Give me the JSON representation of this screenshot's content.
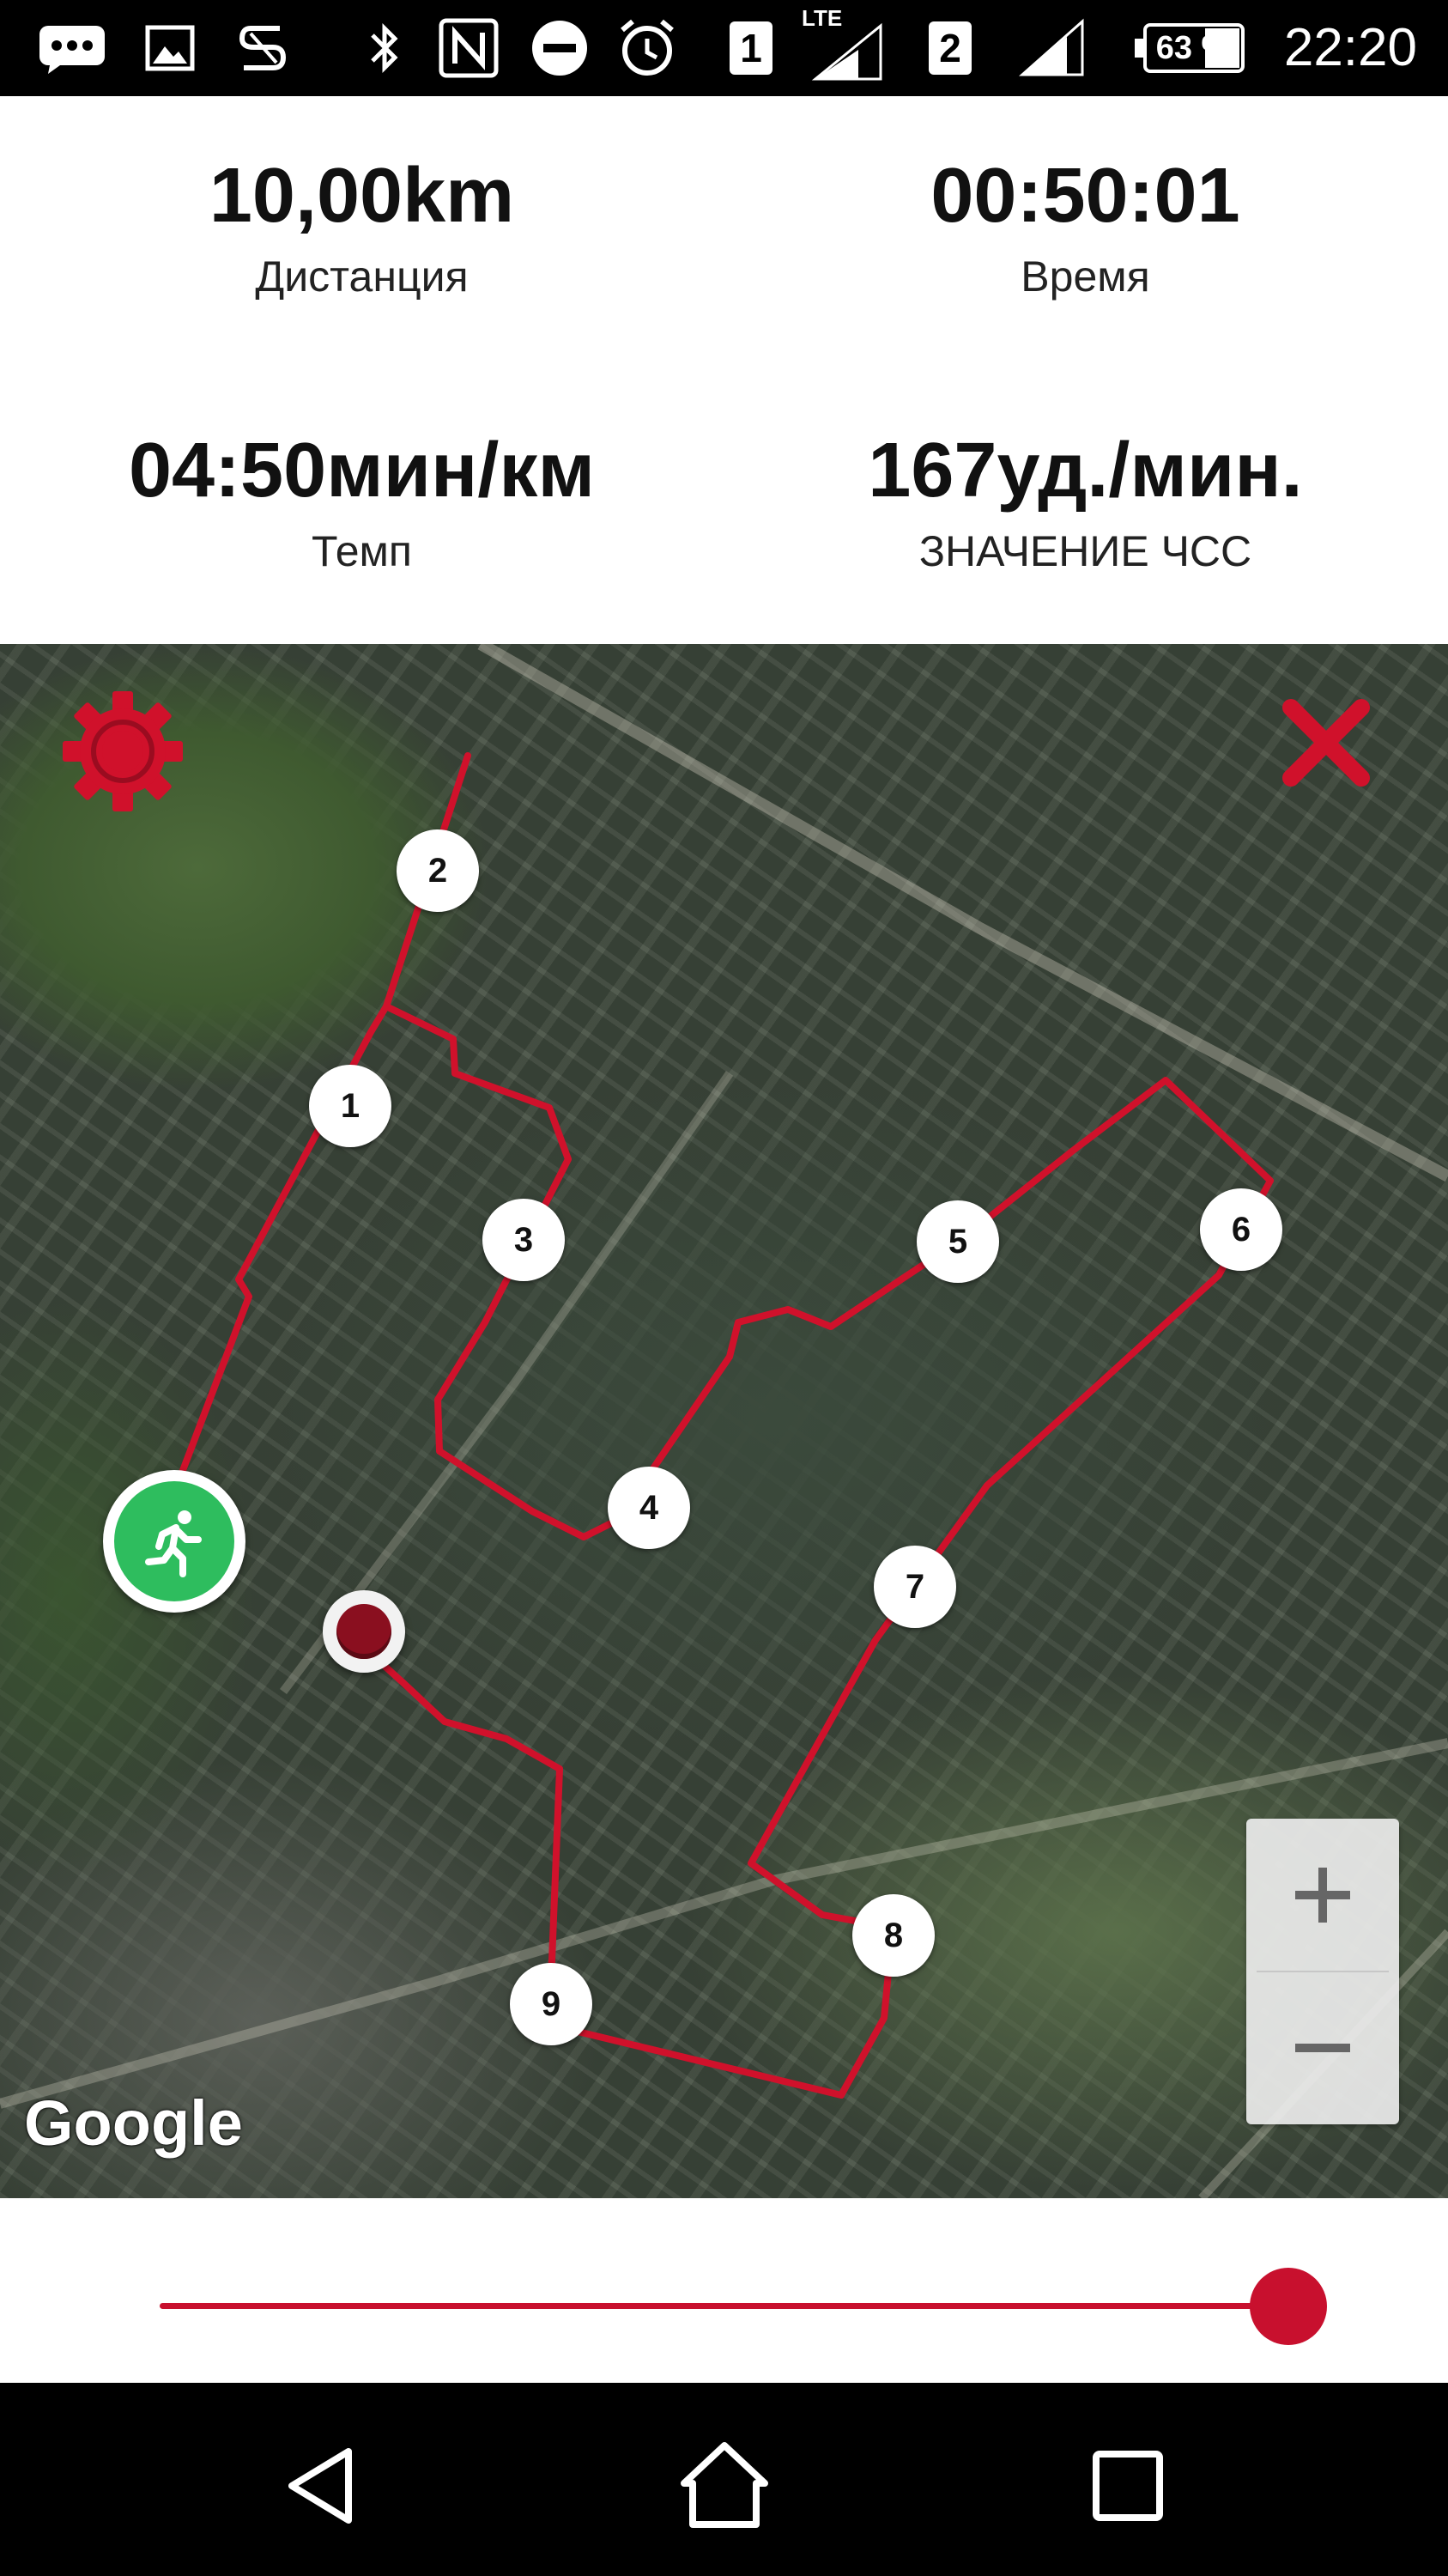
{
  "status_bar": {
    "time": "22:20",
    "battery_percent": "63 %",
    "sim1_label": "1",
    "sim2_label": "2",
    "network_type": "LTE",
    "icons": [
      "chat-icon",
      "image-icon",
      "app-s-icon",
      "bluetooth-icon",
      "nfc-icon",
      "do-not-disturb-icon",
      "alarm-icon",
      "sim1-icon",
      "signal-icon",
      "sim2-icon",
      "signal-icon",
      "battery-icon"
    ]
  },
  "stats": {
    "distance_value": "10,00km",
    "distance_label": "Дистанция",
    "time_value": "00:50:01",
    "time_label": "Время",
    "pace_value": "04:50мин/км",
    "pace_label": "Темп",
    "hr_value": "167уд./мин.",
    "hr_label": "ЗНАЧЕНИЕ ЧСС"
  },
  "map": {
    "provider_logo": "Google",
    "route_color": "#d0112b",
    "km_markers": [
      "1",
      "2",
      "3",
      "4",
      "5",
      "6",
      "7",
      "8",
      "9"
    ],
    "start_icon": "runner-icon",
    "end_icon": "finish-pin-icon",
    "settings_icon": "gear-icon",
    "close_icon": "close-icon",
    "zoom_in_icon": "plus-icon",
    "zoom_out_icon": "minus-icon"
  },
  "slider": {
    "progress": 1.0,
    "color": "#c8102e"
  },
  "nav_bar": {
    "buttons": [
      "back-icon",
      "home-icon",
      "recents-icon"
    ]
  },
  "colors": {
    "accent": "#c8102e",
    "start_marker": "#2ebd5e",
    "end_marker": "#8a0f1f"
  }
}
